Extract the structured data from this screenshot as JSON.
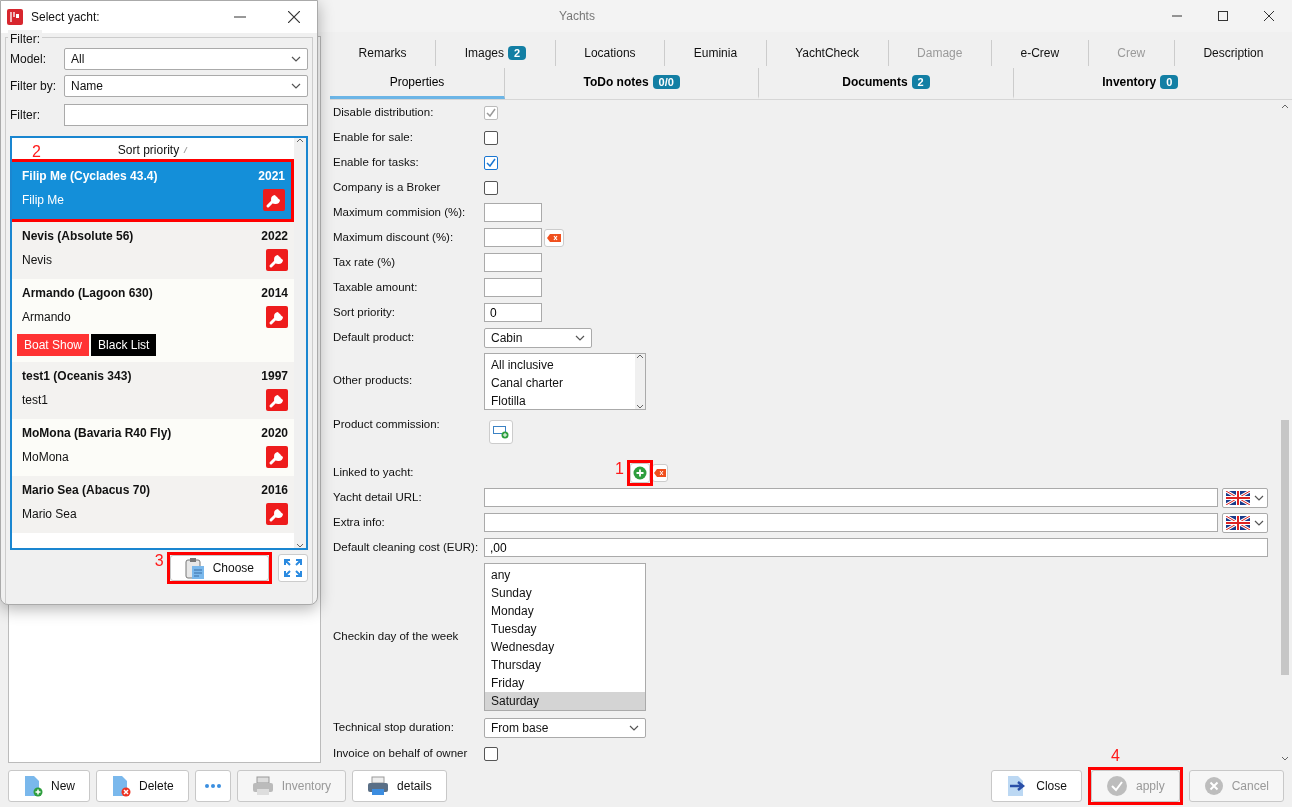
{
  "window": {
    "title": "Yachts"
  },
  "tabs_primary": [
    {
      "label": "Remarks",
      "selected": false,
      "disabled": false
    },
    {
      "label": "Images",
      "badge": "2",
      "selected": false,
      "disabled": false
    },
    {
      "label": "Locations",
      "selected": false,
      "disabled": false
    },
    {
      "label": "Euminia",
      "selected": false,
      "disabled": false
    },
    {
      "label": "YachtCheck",
      "selected": false,
      "disabled": false
    },
    {
      "label": "Damage",
      "selected": false,
      "disabled": true
    },
    {
      "label": "e-Crew",
      "selected": false,
      "disabled": false
    },
    {
      "label": "Crew",
      "selected": false,
      "disabled": true
    },
    {
      "label": "Description",
      "selected": false,
      "disabled": false
    }
  ],
  "tabs_secondary": [
    {
      "label": "Properties",
      "selected": true
    },
    {
      "label": "ToDo notes",
      "badge": "0/0",
      "selected": false
    },
    {
      "label": "Documents",
      "badge": "2",
      "selected": false
    },
    {
      "label": "Inventory",
      "badge": "0",
      "selected": false
    }
  ],
  "form": {
    "fields": [
      {
        "kind": "checkbox",
        "label": "Disable distribution:",
        "checked": true,
        "disabled": true
      },
      {
        "kind": "checkbox",
        "label": "Enable for sale:",
        "checked": false,
        "disabled": false
      },
      {
        "kind": "checkbox",
        "label": "Enable for tasks:",
        "checked": true,
        "disabled": false
      },
      {
        "kind": "checkbox",
        "label": "Company is a Broker",
        "checked": false,
        "disabled": false
      },
      {
        "kind": "number",
        "label": "Maximum commision (%):"
      },
      {
        "kind": "number",
        "label": "Maximum discount (%):",
        "clearable": true
      },
      {
        "kind": "number",
        "label": "Tax rate (%)"
      },
      {
        "kind": "number",
        "label": "Taxable amount:"
      },
      {
        "kind": "number",
        "label": "Sort priority:",
        "value": "0"
      },
      {
        "kind": "select",
        "label": "Default product:",
        "value": "Cabin"
      },
      {
        "kind": "listbox",
        "label": "Other products:",
        "options": [
          {
            "label": "All inclusive",
            "selected": false
          },
          {
            "label": "Canal charter",
            "selected": false
          },
          {
            "label": "Flotilla",
            "selected": false
          }
        ]
      },
      {
        "kind": "addbutton",
        "label": "Product commission:"
      },
      {
        "kind": "linked",
        "label": "Linked to yacht:",
        "marker": "1"
      },
      {
        "kind": "url",
        "label": "Yacht detail URL:"
      },
      {
        "kind": "url",
        "label": "Extra info:"
      },
      {
        "kind": "text",
        "label": "Default cleaning cost (EUR):",
        "value": ",00"
      },
      {
        "kind": "daylist",
        "label": "Checkin day of the week",
        "options": [
          {
            "label": "any",
            "selected": false
          },
          {
            "label": "Sunday",
            "selected": false
          },
          {
            "label": "Monday",
            "selected": false
          },
          {
            "label": "Tuesday",
            "selected": false
          },
          {
            "label": "Wednesday",
            "selected": false
          },
          {
            "label": "Thursday",
            "selected": false
          },
          {
            "label": "Friday",
            "selected": false
          },
          {
            "label": "Saturday",
            "selected": true
          }
        ]
      },
      {
        "kind": "wideselect",
        "label": "Technical stop duration:",
        "value": "From base"
      },
      {
        "kind": "checkbox",
        "label": "Invoice on behalf of owner",
        "checked": false,
        "disabled": false
      }
    ]
  },
  "footer": {
    "left": [
      {
        "kind": "new",
        "label": "New",
        "disabled": false
      },
      {
        "kind": "delete",
        "label": "Delete",
        "disabled": false
      },
      {
        "kind": "more"
      },
      {
        "kind": "print",
        "label": "Inventory",
        "disabled": true
      },
      {
        "kind": "print",
        "label": "details",
        "disabled": false
      }
    ],
    "right": [
      {
        "kind": "close",
        "label": "Close",
        "disabled": false
      },
      {
        "kind": "apply",
        "label": "apply",
        "disabled": true,
        "marker": "4"
      },
      {
        "kind": "cancel",
        "label": "Cancel",
        "disabled": true
      }
    ]
  },
  "dialog": {
    "title": "Select yacht:",
    "filter_group": "Filter:",
    "model": {
      "label": "Model:",
      "value": "All"
    },
    "filter_by": {
      "label": "Filter by:",
      "value": "Name"
    },
    "filter": {
      "label": "Filter:"
    },
    "list_header": "Sort priority",
    "yachts": [
      {
        "title": "Filip Me (Cyclades 43.4)",
        "year": "2021",
        "name": "Filip Me",
        "selected": true,
        "marker": "2"
      },
      {
        "title": "Nevis (Absolute 56)",
        "year": "2022",
        "name": "Nevis",
        "selected": false
      },
      {
        "title": "Armando (Lagoon 630)",
        "year": "2014",
        "name": "Armando",
        "selected": false,
        "tags": [
          {
            "label": "Boat Show",
            "color": "#ff3333"
          },
          {
            "label": "Black List",
            "color": "#000000"
          }
        ]
      },
      {
        "title": "test1 (Oceanis 343)",
        "year": "1997",
        "name": "test1",
        "selected": false
      },
      {
        "title": "MoMona (Bavaria R40 Fly)",
        "year": "2020",
        "name": "MoMona",
        "selected": false
      },
      {
        "title": "Mario Sea (Abacus 70)",
        "year": "2016",
        "name": "Mario Sea",
        "selected": false
      }
    ],
    "choose": {
      "label": "Choose",
      "marker": "3"
    }
  }
}
